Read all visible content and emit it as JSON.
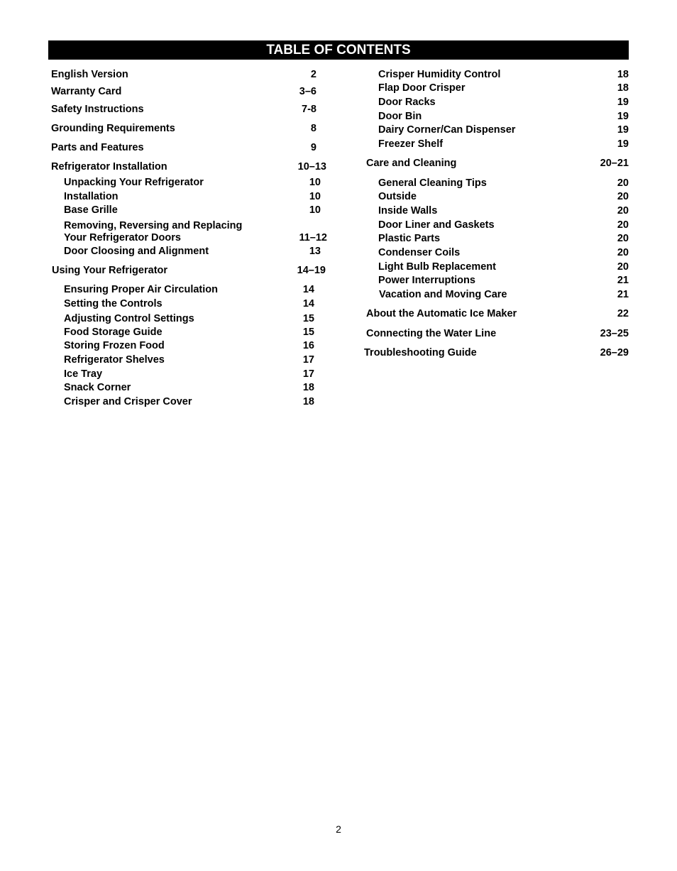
{
  "title": "TABLE OF CONTENTS",
  "left_column": [
    {
      "label": "English Version",
      "page": "2"
    },
    {
      "label": "Warranty Card",
      "page": "3–6"
    },
    {
      "label": "Safety Instructions",
      "page": "7-8"
    },
    {
      "label": "Grounding  Requirements",
      "page": "8"
    },
    {
      "label": "Parts and Features",
      "page": "9"
    },
    {
      "label": "Refrigerator  Installation",
      "page": "10–13"
    },
    {
      "label": "Unpacking Your Refrigerator",
      "page": "10"
    },
    {
      "label": "Installation",
      "page": "10"
    },
    {
      "label": "Base Grille",
      "page": "10"
    },
    {
      "label": "Removing,  Reversing and Replacing",
      "page": ""
    },
    {
      "label": "Your Refrigerator Doors",
      "page": "11–12"
    },
    {
      "label": "Door Cloosing and Alignment",
      "page": "13"
    },
    {
      "label": "Using Your Refrigerator",
      "page": "14–19"
    },
    {
      "label": "Ensuring Proper Air Circulation",
      "page": "14"
    },
    {
      "label": "Setting the Controls",
      "page": "14"
    },
    {
      "label": "Adjusting  Control Settings",
      "page": "15"
    },
    {
      "label": "Food Storage Guide",
      "page": "15"
    },
    {
      "label": "Storing Frozen Food",
      "page": "16"
    },
    {
      "label": "Refrigerator Shelves",
      "page": "17"
    },
    {
      "label": "Ice Tray",
      "page": "17"
    },
    {
      "label": "Snack Corner",
      "page": "18"
    },
    {
      "label": "Crisper and Crisper Cover",
      "page": "18"
    }
  ],
  "right_column": [
    {
      "label": "Crisper  Humidity Control",
      "page": "18"
    },
    {
      "label": "Flap Door Crisper",
      "page": "18"
    },
    {
      "label": "Door  Racks",
      "page": "19"
    },
    {
      "label": "Door  Bin",
      "page": "19"
    },
    {
      "label": "Dairy Corner/Can Dispenser",
      "page": "19"
    },
    {
      "label": "Freezer  Shelf",
      "page": "19"
    },
    {
      "label": "Care  and Cleaning",
      "page": "20–21"
    },
    {
      "label": "General  Cleaning Tips",
      "page": "20"
    },
    {
      "label": "Outside",
      "page": "20"
    },
    {
      "label": "Inside Walls",
      "page": "20"
    },
    {
      "label": "Door  Liner and Gaskets",
      "page": "20"
    },
    {
      "label": "Plastic Parts",
      "page": "20"
    },
    {
      "label": "Condenser  Coils",
      "page": "20"
    },
    {
      "label": "Light  Bulb Replacement",
      "page": "20"
    },
    {
      "label": "Power Interruptions",
      "page": "21"
    },
    {
      "label": "Vacation and Moving Care",
      "page": "21"
    },
    {
      "label": "About the Automatic Ice Maker",
      "page": "22"
    },
    {
      "label": "Connecting the Water Line",
      "page": "23–25"
    },
    {
      "label": "Troubleshooting Guide",
      "page": "26–29"
    }
  ],
  "page_number": "2"
}
